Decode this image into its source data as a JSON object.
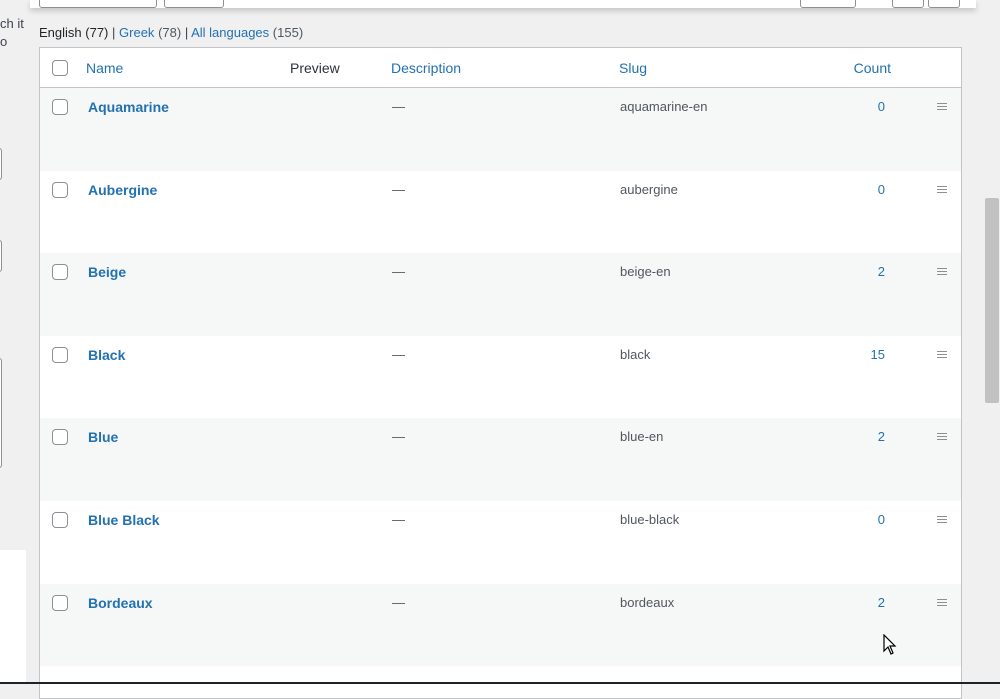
{
  "left_fragment": {
    "line1": "ch it",
    "line2": "o"
  },
  "views": {
    "english": {
      "label": "English",
      "count": "(77)"
    },
    "sep": "|",
    "greek": {
      "label": "Greek",
      "count": "(78)"
    },
    "all": {
      "label": "All languages",
      "count": "(155)"
    }
  },
  "table": {
    "headers": {
      "name": "Name",
      "preview": "Preview",
      "description": "Description",
      "slug": "Slug",
      "count": "Count"
    },
    "rows": [
      {
        "name": "Aquamarine",
        "description": "—",
        "slug": "aquamarine-en",
        "count": "0"
      },
      {
        "name": "Aubergine",
        "description": "—",
        "slug": "aubergine",
        "count": "0"
      },
      {
        "name": "Beige",
        "description": "—",
        "slug": "beige-en",
        "count": "2"
      },
      {
        "name": "Black",
        "description": "—",
        "slug": "black",
        "count": "15"
      },
      {
        "name": "Blue",
        "description": "—",
        "slug": "blue-en",
        "count": "2"
      },
      {
        "name": "Blue Black",
        "description": "—",
        "slug": "blue-black",
        "count": "0"
      },
      {
        "name": "Bordeaux",
        "description": "—",
        "slug": "bordeaux",
        "count": "2"
      }
    ]
  },
  "icons": {
    "row_handle": "drag-handle-icon",
    "cursor": "mouse-pointer-icon"
  },
  "colors": {
    "link": "#2271b1",
    "border": "#c3c4c7",
    "alt_row": "#f6f7f7"
  }
}
